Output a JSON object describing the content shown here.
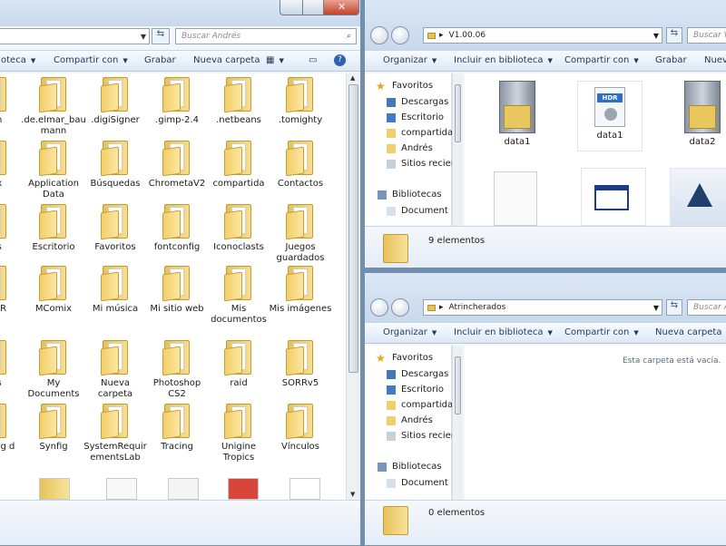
{
  "left_window": {
    "search_placeholder": "Buscar Andrés",
    "toolbar": {
      "library": "oteca",
      "share": "Compartir con",
      "burn": "Grabar",
      "new_folder": "Nueva carpeta"
    },
    "items": [
      [
        "oph",
        ".de.elmar_baumann",
        ".digiSigner",
        ".gimp-2.4",
        ".netbeans",
        ".tomighty"
      ],
      [
        "Box",
        "Application Data",
        "Búsquedas",
        "ChrometaV2",
        "compartida",
        "Contactos"
      ],
      [
        "gas",
        "Escritorio",
        "Favoritos",
        "fontconfig",
        "Iconoclasts",
        "Juegos guardados"
      ],
      [
        "nce R",
        "MComix",
        "Mi música",
        "Mi sitio web",
        "Mis documentos",
        "Mis imágenes"
      ],
      [
        "eos",
        "My Documents",
        "Nueva carpeta",
        "Photoshop CS2",
        "raid",
        "SORRv5"
      ],
      [
        "r-Th ing d",
        "Synfig",
        "SystemRequirementsLab",
        "Tracing",
        "Unigine Tropics",
        "Vínculos"
      ]
    ]
  },
  "top_right_window": {
    "path": "V1.00.06",
    "search_placeholder": "Buscar V",
    "toolbar": {
      "organize": "Organizar",
      "library": "Incluir en biblioteca",
      "share": "Compartir con",
      "burn": "Grabar",
      "new": "Nuev"
    },
    "nav": {
      "favorites": "Favoritos",
      "downloads": "Descargas",
      "desktop": "Escritorio",
      "shared": "compartida",
      "user": "Andrés",
      "recent": "Sitios recien",
      "libraries": "Bibliotecas",
      "documents": "Document"
    },
    "files": [
      "data1",
      "data1",
      "data2"
    ],
    "status": "9 elementos"
  },
  "bottom_right_window": {
    "path": "Atrincherados",
    "search_placeholder": "Buscar A",
    "toolbar": {
      "organize": "Organizar",
      "library": "Incluir en biblioteca",
      "share": "Compartir con",
      "new_folder": "Nueva carpeta"
    },
    "nav": {
      "favorites": "Favoritos",
      "downloads": "Descargas",
      "desktop": "Escritorio",
      "shared": "compartida",
      "user": "Andrés",
      "recent": "Sitios recien",
      "libraries": "Bibliotecas",
      "documents": "Document"
    },
    "empty_message": "Esta carpeta está vacía.",
    "status": "0 elementos"
  },
  "colors": {
    "accent": "#3a6ea5",
    "folder": "#f3cf6a",
    "window_frame": "#c8d9ec"
  }
}
